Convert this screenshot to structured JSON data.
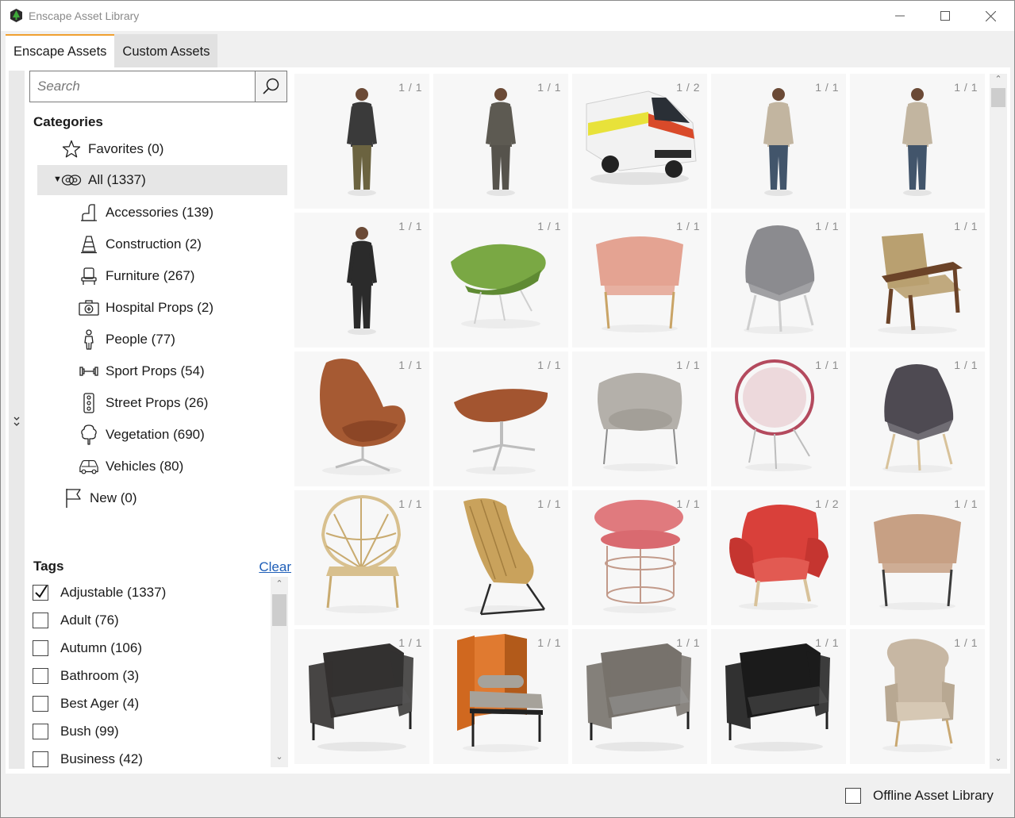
{
  "window": {
    "title": "Enscape Asset Library"
  },
  "tabs": [
    {
      "label": "Enscape Assets",
      "active": true
    },
    {
      "label": "Custom Assets",
      "active": false
    }
  ],
  "search": {
    "placeholder": "Search"
  },
  "categories": {
    "title": "Categories",
    "items": [
      {
        "label": "Favorites (0)",
        "icon": "star-icon"
      },
      {
        "label": "All (1337)",
        "icon": "all-assets-icon",
        "selected": true,
        "expanded": true
      },
      {
        "label": "Accessories (139)",
        "icon": "accessories-icon"
      },
      {
        "label": "Construction (2)",
        "icon": "traffic-cone-icon"
      },
      {
        "label": "Furniture (267)",
        "icon": "chair-icon"
      },
      {
        "label": "Hospital Props (2)",
        "icon": "medical-kit-icon"
      },
      {
        "label": "People (77)",
        "icon": "person-icon"
      },
      {
        "label": "Sport Props (54)",
        "icon": "dumbbell-icon"
      },
      {
        "label": "Street Props (26)",
        "icon": "traffic-light-icon"
      },
      {
        "label": "Vegetation (690)",
        "icon": "tree-icon"
      },
      {
        "label": "Vehicles (80)",
        "icon": "car-icon"
      },
      {
        "label": "New (0)",
        "icon": "flag-icon"
      }
    ]
  },
  "tags": {
    "title": "Tags",
    "clear_label": "Clear",
    "items": [
      {
        "label": "Adjustable (1337)",
        "checked": true
      },
      {
        "label": "Adult (76)",
        "checked": false
      },
      {
        "label": "Autumn (106)",
        "checked": false
      },
      {
        "label": "Bathroom (3)",
        "checked": false
      },
      {
        "label": "Best Ager (4)",
        "checked": false
      },
      {
        "label": "Bush (99)",
        "checked": false
      },
      {
        "label": "Business (42)",
        "checked": false
      }
    ]
  },
  "assets": [
    {
      "badge": "1 / 1",
      "kind": "person",
      "colors": [
        "#3a3a3a",
        "#6b6340"
      ]
    },
    {
      "badge": "1 / 1",
      "kind": "person",
      "colors": [
        "#5d5a52",
        "#56534c"
      ]
    },
    {
      "badge": "1 / 2",
      "kind": "ambulance",
      "colors": [
        "#f2f2f2",
        "#e8e23a"
      ]
    },
    {
      "badge": "1 / 1",
      "kind": "person",
      "colors": [
        "#c2b5a0",
        "#42556b"
      ]
    },
    {
      "badge": "1 / 1",
      "kind": "person",
      "colors": [
        "#c2b5a0",
        "#42556b"
      ]
    },
    {
      "badge": "1 / 1",
      "kind": "person",
      "colors": [
        "#2b2b2b",
        "#2b2b2b"
      ]
    },
    {
      "badge": "1 / 1",
      "kind": "lounge",
      "colors": [
        "#7aa844",
        "#cfcfcf"
      ]
    },
    {
      "badge": "1 / 1",
      "kind": "tub",
      "colors": [
        "#e4a392",
        "#c9a466"
      ]
    },
    {
      "badge": "1 / 1",
      "kind": "shell",
      "colors": [
        "#8b8b8f",
        "#cfcfcf"
      ]
    },
    {
      "badge": "1 / 1",
      "kind": "armchair-wood",
      "colors": [
        "#b9a070",
        "#6b4328"
      ]
    },
    {
      "badge": "1 / 1",
      "kind": "egg",
      "colors": [
        "#a65a33",
        "#bdbdbd"
      ]
    },
    {
      "badge": "1 / 1",
      "kind": "ottoman",
      "colors": [
        "#a35530",
        "#bdbdbd"
      ]
    },
    {
      "badge": "1 / 1",
      "kind": "womb",
      "colors": [
        "#b4b0aa",
        "#8c8c8c"
      ]
    },
    {
      "badge": "1 / 1",
      "kind": "hoop",
      "colors": [
        "#d9a0a8",
        "#bdbdbd"
      ]
    },
    {
      "badge": "1 / 1",
      "kind": "shell",
      "colors": [
        "#4e4a52",
        "#d8c29a"
      ]
    },
    {
      "badge": "1 / 1",
      "kind": "peacock",
      "colors": [
        "#d8c08e",
        "#c9ab70"
      ]
    },
    {
      "badge": "1 / 1",
      "kind": "rattan",
      "colors": [
        "#c9a25c",
        "#2b2b2b"
      ]
    },
    {
      "badge": "1 / 1",
      "kind": "stool",
      "colors": [
        "#e07a7e",
        "#c29a8a"
      ]
    },
    {
      "badge": "1 / 2",
      "kind": "armchair-soft",
      "colors": [
        "#d9403a",
        "#d8c29a"
      ]
    },
    {
      "badge": "1 / 1",
      "kind": "tub",
      "colors": [
        "#c7a084",
        "#3b3b3b"
      ]
    },
    {
      "badge": "1 / 1",
      "kind": "club",
      "colors": [
        "#333130",
        "#555"
      ]
    },
    {
      "badge": "1 / 1",
      "kind": "highback",
      "colors": [
        "#d0681f",
        "#a6a29a"
      ]
    },
    {
      "badge": "1 / 1",
      "kind": "club",
      "colors": [
        "#77726c",
        "#999"
      ]
    },
    {
      "badge": "1 / 1",
      "kind": "club",
      "colors": [
        "#1b1b1b",
        "#555"
      ]
    },
    {
      "badge": "1 / 1",
      "kind": "wingback",
      "colors": [
        "#c7b7a3",
        "#c9a872"
      ]
    }
  ],
  "footer": {
    "offline_label": "Offline Asset Library",
    "offline_checked": false
  },
  "colors": {
    "accent": "#f0a030",
    "link": "#1f5fb8",
    "selection": "#e6e6e6"
  }
}
